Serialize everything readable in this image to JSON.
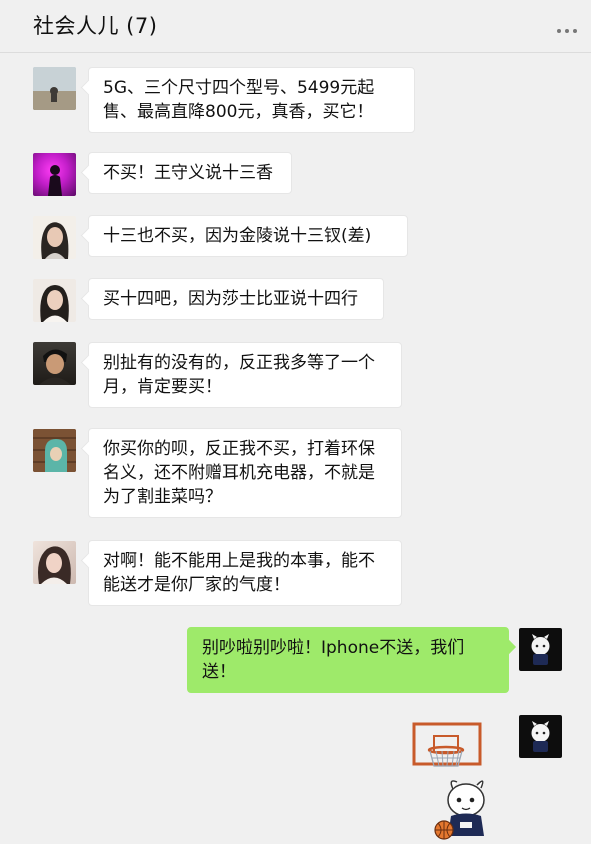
{
  "header": {
    "title": "社会人儿 (7)",
    "more_icon": "more-dots-icon"
  },
  "messages": [
    {
      "side": "left",
      "text": "5G、三个尺寸四个型号、5499元起售、最高直降800元，真香，买它！",
      "avatar": "avatar-1"
    },
    {
      "side": "left",
      "text": "不买！王守义说十三香",
      "avatar": "avatar-2"
    },
    {
      "side": "left",
      "text": "十三也不买，因为金陵说十三钗(差)",
      "avatar": "avatar-3"
    },
    {
      "side": "left",
      "text": "买十四吧，因为莎士比亚说十四行",
      "avatar": "avatar-4"
    },
    {
      "side": "left",
      "text": "别扯有的没有的，反正我多等了一个月，肯定要买！",
      "avatar": "avatar-5"
    },
    {
      "side": "left",
      "text": "你买你的呗，反正我不买，打着环保名义，还不附赠耳机充电器，不就是为了割韭菜吗？",
      "avatar": "avatar-6"
    },
    {
      "side": "left",
      "text": "对啊！能不能用上是我的本事，能不能送才是你厂家的气度！",
      "avatar": "avatar-7"
    },
    {
      "side": "right",
      "text": "别吵啦别吵啦！Iphone不送，我们送！",
      "avatar": "avatar-me"
    },
    {
      "side": "right",
      "type": "sticker",
      "sticker": "basketball-mascot-sticker",
      "avatar": "avatar-me"
    }
  ],
  "colors": {
    "background": "#f0f0f0",
    "bubble_left": "#ffffff",
    "bubble_right": "#9eea6a",
    "mascot_badge": "#1e2a55",
    "hoop": "#c85a2a",
    "ball": "#e5782f"
  }
}
